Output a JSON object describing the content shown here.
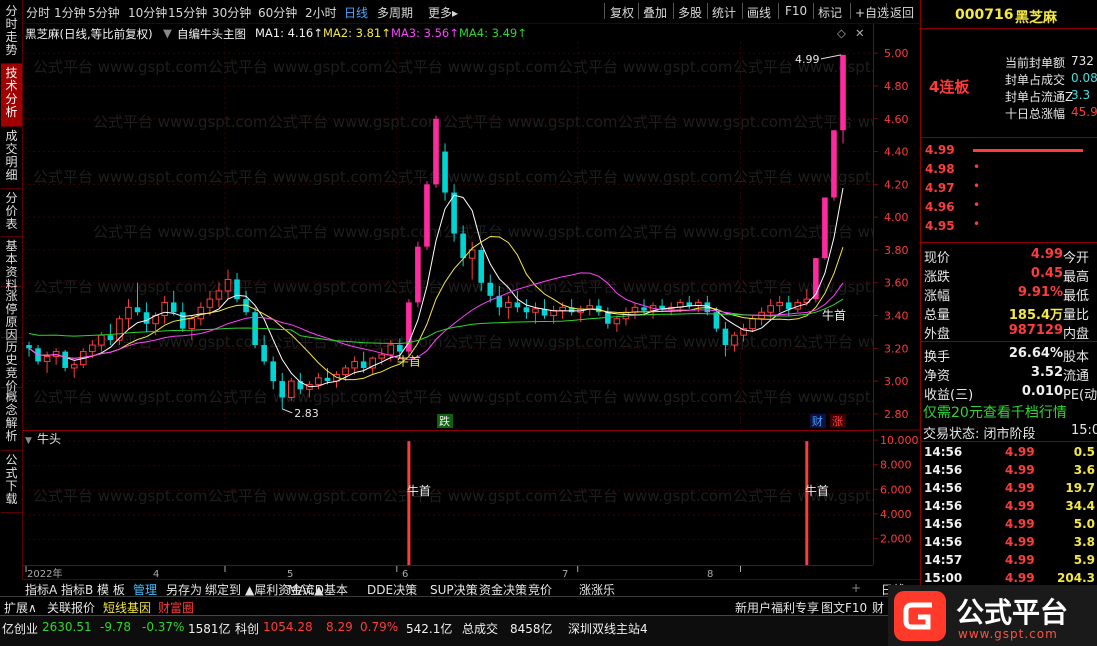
{
  "toolbar": {
    "timeframes": [
      "分时",
      "1分钟",
      "5分钟",
      "10分钟",
      "15分钟",
      "30分钟",
      "60分钟",
      "2小时",
      "日线",
      "多周期",
      "更多▸"
    ],
    "active": "日线",
    "buttons": [
      "复权",
      "叠加",
      "多股",
      "统计",
      "画线",
      "F10",
      "标记",
      "+自选",
      "返回"
    ]
  },
  "sidetabs": [
    "分时走势",
    "技术分析",
    "成交明细",
    "分价表",
    "基本资料",
    "涨停原因",
    "历史竞价",
    "概念解析",
    "公式下载"
  ],
  "sidetab_active": "技术分析",
  "legend": {
    "title": "黑芝麻(日线,等比前复权)",
    "formula": "自编牛头主图",
    "ma1": "MA1: 4.16↑",
    "ma2": "MA2: 3.81↑",
    "ma3": "MA3: 3.56↑",
    "ma4": "MA4: 3.49↑",
    "sub_title": "牛头"
  },
  "watermark": "公式平台 www.gspt.com",
  "yaxis_main": [
    "5.00",
    "4.80",
    "4.60",
    "4.40",
    "4.20",
    "4.00",
    "3.80",
    "3.60",
    "3.40",
    "3.20",
    "3.00",
    "2.80"
  ],
  "yaxis_sub": [
    "10.000",
    "8.000",
    "6.000",
    "4.000",
    "2.000"
  ],
  "xaxis": [
    "2022年",
    "4",
    "5",
    "6",
    "7",
    "8"
  ],
  "annotations": {
    "high": "4.99",
    "low": "2.83",
    "niushou": "牛首",
    "die": "跌",
    "cai": "财",
    "zhang": "涨"
  },
  "chart_data": {
    "type": "candlestick",
    "ylim": [
      2.72,
      5.05
    ],
    "start_label": "2022年",
    "ohlc": [
      [
        3.22,
        3.24,
        3.15,
        3.2
      ],
      [
        3.2,
        3.22,
        3.1,
        3.12
      ],
      [
        3.12,
        3.18,
        3.05,
        3.15
      ],
      [
        3.15,
        3.2,
        3.1,
        3.18
      ],
      [
        3.18,
        3.19,
        3.06,
        3.08
      ],
      [
        3.08,
        3.12,
        3.02,
        3.1
      ],
      [
        3.1,
        3.2,
        3.08,
        3.18
      ],
      [
        3.18,
        3.25,
        3.14,
        3.22
      ],
      [
        3.22,
        3.3,
        3.18,
        3.28
      ],
      [
        3.28,
        3.35,
        3.22,
        3.25
      ],
      [
        3.25,
        3.4,
        3.22,
        3.38
      ],
      [
        3.38,
        3.5,
        3.32,
        3.45
      ],
      [
        3.45,
        3.6,
        3.4,
        3.42
      ],
      [
        3.42,
        3.48,
        3.3,
        3.35
      ],
      [
        3.35,
        3.42,
        3.28,
        3.4
      ],
      [
        3.4,
        3.52,
        3.35,
        3.48
      ],
      [
        3.48,
        3.55,
        3.4,
        3.42
      ],
      [
        3.42,
        3.48,
        3.3,
        3.32
      ],
      [
        3.32,
        3.4,
        3.25,
        3.38
      ],
      [
        3.38,
        3.48,
        3.34,
        3.45
      ],
      [
        3.45,
        3.55,
        3.4,
        3.5
      ],
      [
        3.5,
        3.6,
        3.45,
        3.55
      ],
      [
        3.55,
        3.68,
        3.5,
        3.62
      ],
      [
        3.62,
        3.66,
        3.48,
        3.5
      ],
      [
        3.5,
        3.55,
        3.4,
        3.42
      ],
      [
        3.42,
        3.45,
        3.2,
        3.22
      ],
      [
        3.22,
        3.28,
        3.1,
        3.12
      ],
      [
        3.12,
        3.15,
        2.95,
        3.0
      ],
      [
        3.0,
        3.05,
        2.83,
        2.9
      ],
      [
        2.9,
        3.02,
        2.88,
        3.0
      ],
      [
        3.0,
        3.05,
        2.92,
        2.95
      ],
      [
        2.95,
        3.0,
        2.9,
        2.98
      ],
      [
        2.98,
        3.05,
        2.95,
        3.02
      ],
      [
        3.02,
        3.08,
        2.98,
        3.0
      ],
      [
        3.0,
        3.06,
        2.96,
        3.04
      ],
      [
        3.04,
        3.1,
        3.0,
        3.08
      ],
      [
        3.08,
        3.15,
        3.04,
        3.12
      ],
      [
        3.12,
        3.18,
        3.05,
        3.08
      ],
      [
        3.08,
        3.15,
        3.04,
        3.14
      ],
      [
        3.14,
        3.2,
        3.1,
        3.16
      ],
      [
        3.16,
        3.25,
        3.12,
        3.22
      ],
      [
        3.22,
        3.26,
        3.14,
        3.18
      ],
      [
        3.18,
        3.5,
        3.15,
        3.48
      ],
      [
        3.48,
        3.85,
        3.45,
        3.82
      ],
      [
        3.82,
        4.22,
        3.8,
        4.2
      ],
      [
        4.2,
        4.62,
        4.18,
        4.6
      ],
      [
        4.4,
        4.45,
        4.1,
        4.15
      ],
      [
        4.15,
        4.2,
        3.85,
        3.9
      ],
      [
        3.9,
        3.95,
        3.7,
        3.75
      ],
      [
        3.75,
        3.85,
        3.62,
        3.8
      ],
      [
        3.8,
        3.82,
        3.55,
        3.6
      ],
      [
        3.6,
        3.65,
        3.48,
        3.52
      ],
      [
        3.52,
        3.58,
        3.4,
        3.45
      ],
      [
        3.45,
        3.52,
        3.38,
        3.48
      ],
      [
        3.48,
        3.55,
        3.42,
        3.45
      ],
      [
        3.45,
        3.5,
        3.38,
        3.42
      ],
      [
        3.42,
        3.48,
        3.35,
        3.44
      ],
      [
        3.44,
        3.5,
        3.38,
        3.4
      ],
      [
        3.4,
        3.46,
        3.35,
        3.43
      ],
      [
        3.43,
        3.48,
        3.38,
        3.45
      ],
      [
        3.45,
        3.5,
        3.4,
        3.42
      ],
      [
        3.42,
        3.46,
        3.36,
        3.44
      ],
      [
        3.44,
        3.5,
        3.4,
        3.46
      ],
      [
        3.46,
        3.5,
        3.4,
        3.42
      ],
      [
        3.42,
        3.45,
        3.32,
        3.35
      ],
      [
        3.35,
        3.4,
        3.3,
        3.38
      ],
      [
        3.38,
        3.45,
        3.34,
        3.42
      ],
      [
        3.42,
        3.48,
        3.38,
        3.45
      ],
      [
        3.45,
        3.5,
        3.4,
        3.43
      ],
      [
        3.43,
        3.48,
        3.38,
        3.46
      ],
      [
        3.46,
        3.5,
        3.42,
        3.44
      ],
      [
        3.44,
        3.48,
        3.4,
        3.45
      ],
      [
        3.45,
        3.5,
        3.42,
        3.48
      ],
      [
        3.48,
        3.52,
        3.44,
        3.46
      ],
      [
        3.46,
        3.5,
        3.42,
        3.48
      ],
      [
        3.48,
        3.52,
        3.4,
        3.42
      ],
      [
        3.42,
        3.45,
        3.3,
        3.32
      ],
      [
        3.32,
        3.36,
        3.15,
        3.22
      ],
      [
        3.22,
        3.3,
        3.18,
        3.28
      ],
      [
        3.28,
        3.35,
        3.24,
        3.32
      ],
      [
        3.32,
        3.4,
        3.3,
        3.38
      ],
      [
        3.38,
        3.45,
        3.34,
        3.42
      ],
      [
        3.42,
        3.5,
        3.38,
        3.46
      ],
      [
        3.46,
        3.52,
        3.42,
        3.48
      ],
      [
        3.48,
        3.52,
        3.4,
        3.44
      ],
      [
        3.44,
        3.5,
        3.42,
        3.48
      ],
      [
        3.48,
        3.56,
        3.46,
        3.5
      ],
      [
        3.5,
        3.75,
        3.48,
        3.75
      ],
      [
        3.75,
        4.12,
        3.74,
        4.12
      ],
      [
        4.12,
        4.53,
        4.1,
        4.53
      ],
      [
        4.53,
        4.99,
        4.45,
        4.99
      ]
    ],
    "ma_lines": [
      {
        "name": "MA1",
        "color": "#ffffff",
        "period": 5
      },
      {
        "name": "MA2",
        "color": "#f4e842",
        "period": 10
      },
      {
        "name": "MA3",
        "color": "#ff40ff",
        "period": 20
      },
      {
        "name": "MA4",
        "color": "#2fd62f",
        "period": 60
      }
    ],
    "niushou_sub": {
      "ylim": [
        0,
        10.5
      ],
      "signals": [
        {
          "index": 42,
          "value": 10
        },
        {
          "index": 86,
          "value": 10
        }
      ]
    },
    "grid": true
  },
  "right": {
    "code": "000716",
    "name": "黑芝麻",
    "lianban": "4连板",
    "seal_labels": [
      "当前封单额",
      "封单占成交",
      "封单占流通Z",
      "十日总涨幅"
    ],
    "seal_values": [
      "732",
      "0.08",
      "3.3",
      "45.9"
    ],
    "asks": [
      {
        "price": "4.99",
        "vol": "",
        "bar": 1.0
      },
      {
        "price": "4.98",
        "vol": "•",
        "bar": 0.02
      },
      {
        "price": "4.97",
        "vol": "•",
        "bar": 0.02
      },
      {
        "price": "4.96",
        "vol": "•",
        "bar": 0.02
      },
      {
        "price": "4.95",
        "vol": "•",
        "bar": 0.02
      }
    ],
    "stats": [
      {
        "l": "现价",
        "v": "4.99",
        "r": "今开"
      },
      {
        "l": "涨跌",
        "v": "0.45",
        "r": "最高"
      },
      {
        "l": "涨幅",
        "v": "9.91%",
        "r": "最低"
      },
      {
        "l": "总量",
        "v": "185.4万",
        "r": "量比"
      },
      {
        "l": "外盘",
        "v": "987129",
        "r": "内盘"
      },
      {
        "l": "换手",
        "v": "26.64%",
        "r": "股本"
      },
      {
        "l": "净资",
        "v": "3.52",
        "r": "流通"
      },
      {
        "l": "收益(三)",
        "v": "0.010",
        "r": "PE(动)"
      }
    ],
    "promo": "仅需20元查看千档行情",
    "trade_status": "交易状态: 闭市阶段",
    "trade_time": "15:0",
    "ticks": [
      {
        "t": "14:56",
        "p": "4.99",
        "v": "0.5"
      },
      {
        "t": "14:56",
        "p": "4.99",
        "v": "3.6"
      },
      {
        "t": "14:56",
        "p": "4.99",
        "v": "19.7"
      },
      {
        "t": "14:56",
        "p": "4.99",
        "v": "34.4"
      },
      {
        "t": "14:56",
        "p": "4.99",
        "v": "5.0"
      },
      {
        "t": "14:56",
        "p": "4.99",
        "v": "3.8"
      },
      {
        "t": "14:57",
        "p": "4.99",
        "v": "5.9"
      },
      {
        "t": "15:00",
        "p": "4.99",
        "v": "204.3"
      }
    ],
    "day_label": "日线"
  },
  "bottom_tabs": [
    "指标A",
    "指标B",
    "模 板",
    "管理",
    "另存为",
    "绑定到",
    "▲犀利资金流▲",
    "MACD基本",
    "DDE决策",
    "SUP决策",
    "资金决策",
    "竞价",
    "涨涨乐"
  ],
  "bottom_tabs2": [
    "扩展∧",
    "关联报价",
    "短线基因",
    "财富圈"
  ],
  "bottom_right": {
    "promo": "新用户福利专享",
    "f10": "图文F10",
    "last": "财"
  },
  "status": {
    "pre": "亿",
    "cy_label": "创业",
    "cy_val": "2630.51",
    "cy_chg": "-9.78",
    "cy_pct": "-0.37%",
    "cy_amt": "1581亿",
    "kc_label": "科创",
    "kc_val": "1054.28",
    "kc_chg": "8.29",
    "kc_pct": "0.79%",
    "kc_amt": "542.1亿",
    "total_label": "总成交",
    "total_amt": "8458亿",
    "station": "深圳双线主站4"
  },
  "logo": {
    "text": "公式平台",
    "url": "www.gspt.com"
  }
}
